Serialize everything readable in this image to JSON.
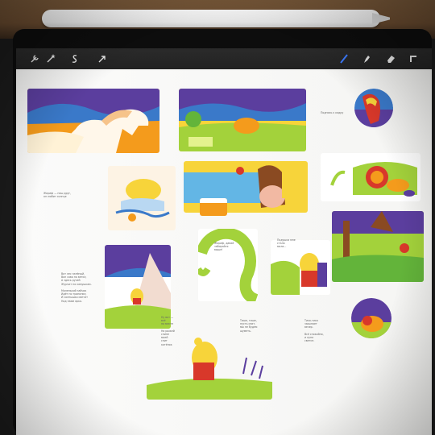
{
  "photo": {
    "subject": "storyboard-on-tablet"
  },
  "toolbar": {
    "icons": [
      "wrench-icon",
      "magic-icon",
      "selection-icon",
      "arrow-icon",
      "brush-icon",
      "smudge-icon",
      "eraser-icon",
      "layers-icon"
    ],
    "accent": "#3d7bff"
  },
  "colors": {
    "orange": "#f49b1c",
    "purple": "#5b3e9e",
    "green": "#a3d23b",
    "yellow": "#f7d43a",
    "red": "#d8382a",
    "blue": "#3a79c9",
    "white": "#ffffff"
  },
  "texts": {
    "t1": "Подпись к кадру",
    "t2": "Жираф — наш друг,\nон любит солнце",
    "t3": "Вот лес зелёный,\nВон сова на ветке,\nА здесь ручей\nЖурчит по камушкам.\n\nМаленький зайчик\nИдёт по тропинке,\nИ солнышко светит\nНад нами ярко.",
    "t4": "Жираф, давай\nзабирайся\nвыше!",
    "t5": "Подушка мне\nстала\nмала...",
    "t6": "Ну вот —\nвсё\nна месте\n\nНа рыжей\nспине\nмоей\nспит\nкотёнок",
    "t7": "Тише, тише,\nпусть спит,\nмы не будем\nшуметь.",
    "t8": "Тихо-тихо\nзасыпает\nвечер.\n\nВсё спокойно,\nи луна\nсветит."
  }
}
